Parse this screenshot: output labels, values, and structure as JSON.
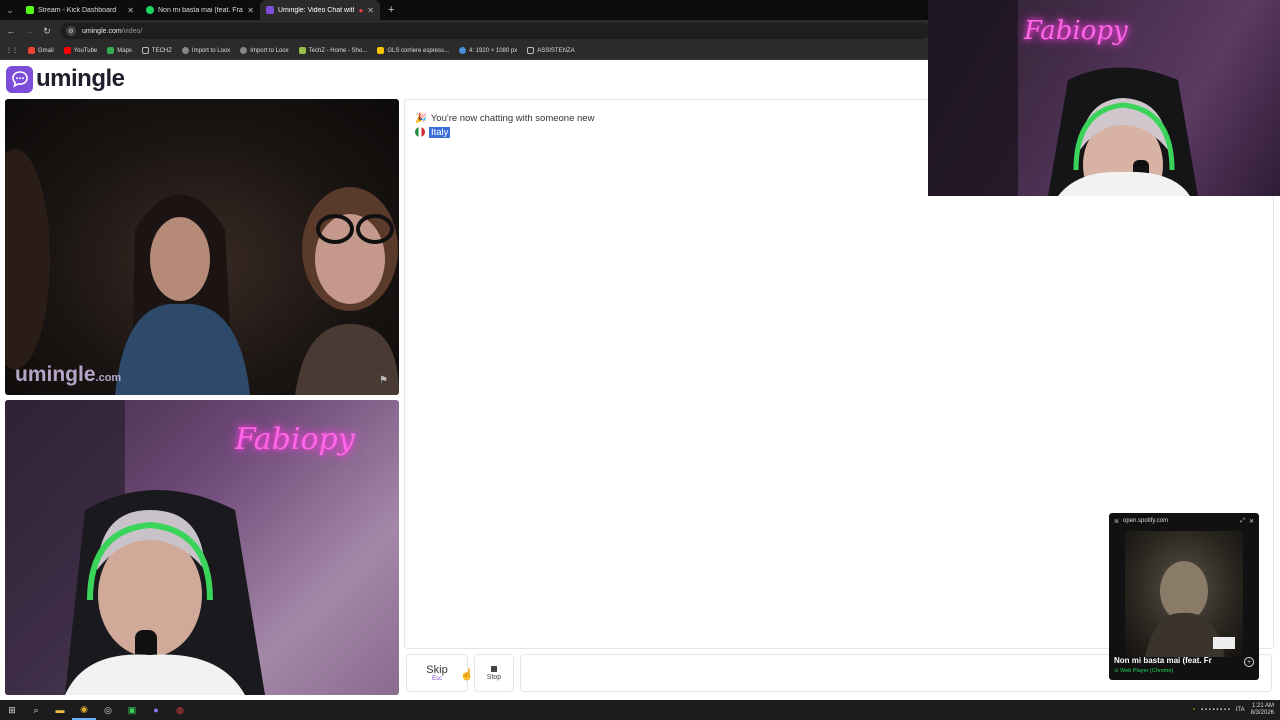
{
  "browser": {
    "tabs": [
      {
        "title": "Stream - Kick Dashboard",
        "color": "#53fc18",
        "active": false
      },
      {
        "title": "Non mi basta mai (feat. Fra",
        "color": "#1ed760",
        "active": false
      },
      {
        "title": "Umingle: Video Chat with S",
        "color": "#7c4dd8",
        "active": true
      }
    ],
    "url_host": "umingle.com",
    "url_path": "/video/",
    "bookmarks": [
      "Gmail",
      "YouTube",
      "Maps",
      "TECHZ",
      "Import to Loox",
      "Import to Loox",
      "TechZ - Home - Sho...",
      "GLS corriere espress...",
      "4: 1920 × 1080 px",
      "ASSISTENZA"
    ]
  },
  "site": {
    "logo_text": "umingle",
    "watermark": "umingle",
    "watermark_suffix": ".com",
    "brand_color": "#7c4dd8"
  },
  "chat": {
    "message": "You're now chatting with someone new",
    "country": "Italy"
  },
  "controls": {
    "skip_label": "Skip",
    "skip_hint": "Esc",
    "stop_label": "Stop"
  },
  "overlay": {
    "neon_text": "Fabiopy"
  },
  "spotify": {
    "site": "open.spotify.com",
    "track": "Non mi basta mai (feat. Fr",
    "source": "Web Player (Chrome)"
  },
  "taskbar": {
    "lang": "ITA",
    "time": "1:21 AM",
    "date": "8/3/2026"
  }
}
